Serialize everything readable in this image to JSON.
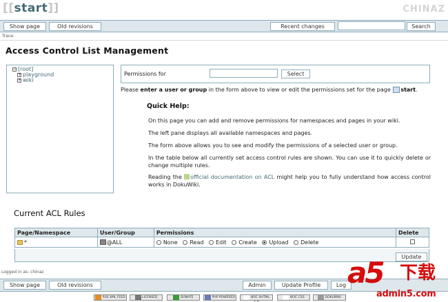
{
  "logo": {
    "open": "[[",
    "text": "start",
    "close": "]]"
  },
  "brand": "CHINAZ",
  "toolbar": {
    "show_page": "Show page",
    "old_revisions": "Old revisions",
    "recent_changes": "Recent changes",
    "search_value": "",
    "search": "Search"
  },
  "trace": "Trace:",
  "title": "Access Control List Management",
  "tree": {
    "root": "[root]",
    "items": [
      "playground",
      "wiki"
    ]
  },
  "perm_form": {
    "label": "Permissions for",
    "value": "",
    "select": "Select"
  },
  "please": {
    "prefix": "Please",
    "bold": "enter a user or group",
    "suffix": "in the form above to view or edit the permissions set for the page",
    "page": "start",
    "end": "."
  },
  "quick_help": {
    "title": "Quick Help:",
    "p1": "On this page you can add and remove permissions for namespaces and pages in your wiki.",
    "p2": "The left pane displays all available namespaces and pages.",
    "p3": "The form above allows you to see and modify the permissions of a selected user or group.",
    "p4": "In the table below all currently set access control rules are shown. You can use it to quickly delete or change multiple rules.",
    "p5_pre": "Reading the",
    "p5_link": "official documentation on ACL",
    "p5_post": "might help you to fully understand how access control works in DokuWiki."
  },
  "acl": {
    "title": "Current ACL Rules",
    "headers": [
      "Page/Namespace",
      "User/Group",
      "Permissions",
      "Delete"
    ],
    "row": {
      "ns": "*",
      "group": "@ALL",
      "perms": [
        "None",
        "Read",
        "Edit",
        "Create",
        "Upload",
        "Delete"
      ],
      "selected": "Upload"
    },
    "update": "Update"
  },
  "logged": "Logged in as: chinaz",
  "bottom": {
    "show_page": "Show page",
    "old_revisions": "Old revisions",
    "admin": "Admin",
    "update_profile": "Update Profile",
    "logout": "Log"
  },
  "badges": [
    "RSS XML FEED",
    "LICENSED",
    "DONATE",
    "PHP POWERED",
    "W3C XHTML 1.0",
    "W3C CSS",
    "DOKUWIKI"
  ],
  "watermark": {
    "mark": "a5",
    "cn": "下载",
    "url": "admin5.com"
  }
}
